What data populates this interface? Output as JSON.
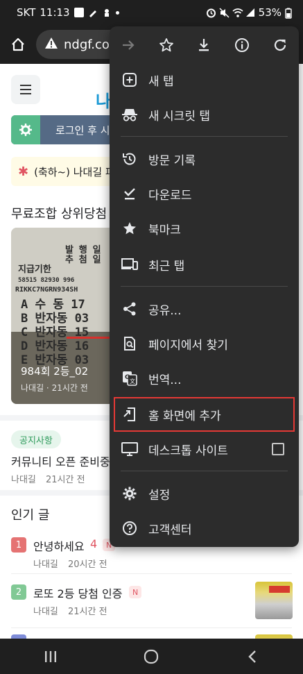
{
  "status": {
    "carrier": "SKT",
    "time": "11:13",
    "battery": "53%"
  },
  "address_bar": {
    "url": "ndgf.co."
  },
  "page": {
    "logo_fragment": "나",
    "login_label": "로그인 후 시",
    "notice_text": "(축하~) 나대길 피",
    "section_top_winners": "무료조합 상위당첨",
    "photo_card": {
      "caption": "984회 2등_02",
      "meta": "나대길 · 21시간 전"
    },
    "notice_tag": "공지사항",
    "notice_post": {
      "title": "커뮤니티 오픈 준비중",
      "author": "나대길",
      "time": "21시간 전"
    },
    "popular_title": "인기 글",
    "popular_posts": [
      {
        "rank": "1",
        "title": "안녕하세요",
        "count": "4",
        "badge": "N",
        "author": "나대길",
        "time": "20시간 전",
        "rank_color": "#e57373"
      },
      {
        "rank": "2",
        "title": "로또 2등 당첨 인증",
        "badge": "N",
        "author": "나대길",
        "time": "21시간 전",
        "rank_color": "#81c995"
      }
    ]
  },
  "menu": {
    "toolbar": [
      "forward-icon",
      "bookmark-star-icon",
      "download-icon",
      "info-icon",
      "refresh-icon"
    ],
    "items": [
      {
        "label": "새 탭",
        "icon": "new-tab-icon"
      },
      {
        "label": "새 시크릿 탭",
        "icon": "incognito-icon"
      },
      {
        "label": "방문 기록",
        "icon": "history-icon"
      },
      {
        "label": "다운로드",
        "icon": "downloads-icon"
      },
      {
        "label": "북마크",
        "icon": "bookmarks-icon"
      },
      {
        "label": "최근 탭",
        "icon": "recent-tabs-icon"
      },
      {
        "label": "공유...",
        "icon": "share-icon"
      },
      {
        "label": "페이지에서 찾기",
        "icon": "find-in-page-icon"
      },
      {
        "label": "번역...",
        "icon": "translate-icon"
      },
      {
        "label": "홈 화면에 추가",
        "icon": "add-to-home-icon"
      },
      {
        "label": "데스크톱 사이트",
        "icon": "desktop-icon"
      },
      {
        "label": "설정",
        "icon": "settings-icon"
      },
      {
        "label": "고객센터",
        "icon": "help-icon"
      }
    ],
    "highlight_color": "#e53935"
  }
}
